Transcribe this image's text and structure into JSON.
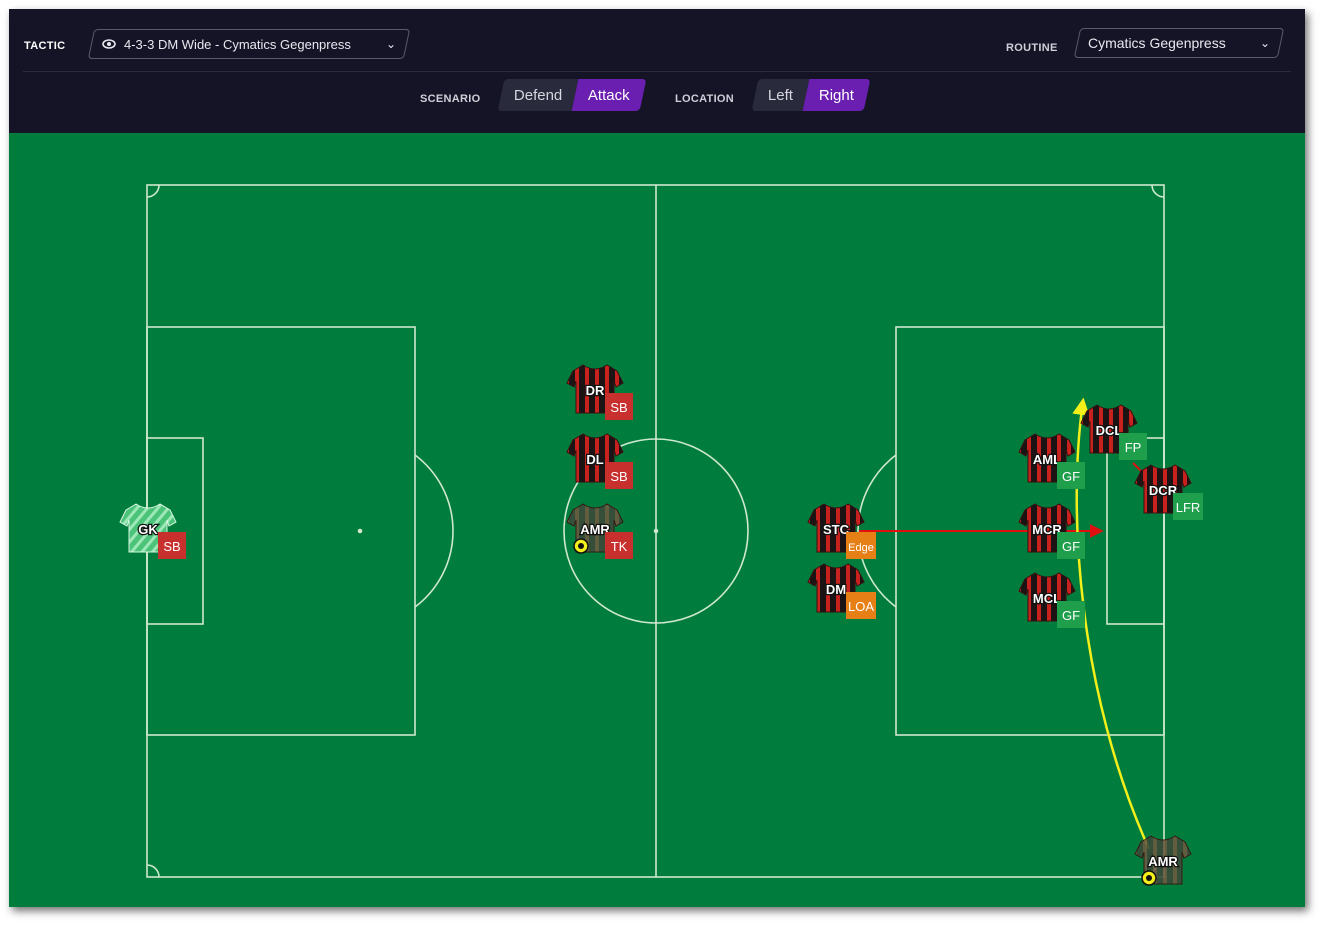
{
  "toolbar": {
    "tactic_label": "TACTIC",
    "tactic_value": "4-3-3 DM Wide - Cymatics Gegenpress",
    "routine_label": "ROUTINE",
    "routine_value": "Cymatics Gegenpress",
    "scenario_label": "SCENARIO",
    "scenario_options": [
      "Defend",
      "Attack"
    ],
    "scenario_selected": "Attack",
    "location_label": "LOCATION",
    "location_options": [
      "Left",
      "Right"
    ],
    "location_selected": "Right"
  },
  "colors": {
    "pitch": "#007d3d",
    "lines": "#cfe8cf",
    "accent_purple": "#6a1fb0",
    "topbar": "#151427",
    "instr_red": "#c8302e",
    "instr_green": "#1f9e4b",
    "instr_orange": "#e57f16",
    "run_arrow": "#e01010",
    "ball_path": "#f2ef1a"
  },
  "players": [
    {
      "pos": "GK",
      "instr": "SB",
      "instr_color": "red",
      "kit": "keeper"
    },
    {
      "pos": "DR",
      "instr": "SB",
      "instr_color": "red",
      "kit": "home"
    },
    {
      "pos": "DL",
      "instr": "SB",
      "instr_color": "red",
      "kit": "home"
    },
    {
      "pos": "AMR",
      "instr": "TK",
      "instr_color": "red",
      "kit": "faded",
      "ball_icon": "ball-icon"
    },
    {
      "pos": "STC",
      "instr": "Edge",
      "instr_color": "orange",
      "kit": "home"
    },
    {
      "pos": "DM",
      "instr": "LOA",
      "instr_color": "orange",
      "kit": "home"
    },
    {
      "pos": "AML",
      "instr": "GF",
      "instr_color": "green",
      "kit": "home"
    },
    {
      "pos": "MCR",
      "instr": "GF",
      "instr_color": "green",
      "kit": "home"
    },
    {
      "pos": "MCL",
      "instr": "GF",
      "instr_color": "green",
      "kit": "home"
    },
    {
      "pos": "DCL",
      "instr": "FP",
      "instr_color": "green",
      "kit": "home"
    },
    {
      "pos": "DCR",
      "instr": "LFR",
      "instr_color": "green",
      "kit": "home"
    },
    {
      "pos": "AMR",
      "instr": "",
      "instr_color": "",
      "kit": "faded",
      "ball_icon": "ball-icon"
    }
  ],
  "paths": [
    {
      "type": "run",
      "from": "STC",
      "to": "MCR",
      "icon": "arrow-icon"
    },
    {
      "type": "ball-path",
      "from": "AMR",
      "to": "DCL",
      "icon": "arrow-icon"
    },
    {
      "type": "link",
      "from": "DCL",
      "to": "DCR"
    }
  ]
}
